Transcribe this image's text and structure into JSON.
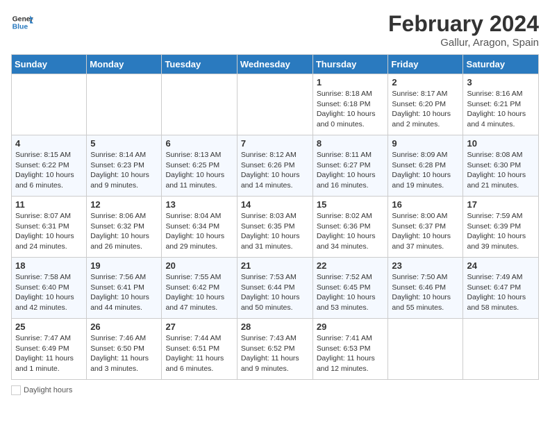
{
  "header": {
    "logo_line1": "General",
    "logo_line2": "Blue",
    "main_title": "February 2024",
    "subtitle": "Gallur, Aragon, Spain"
  },
  "days_of_week": [
    "Sunday",
    "Monday",
    "Tuesday",
    "Wednesday",
    "Thursday",
    "Friday",
    "Saturday"
  ],
  "weeks": [
    [
      {
        "day": "",
        "info": ""
      },
      {
        "day": "",
        "info": ""
      },
      {
        "day": "",
        "info": ""
      },
      {
        "day": "",
        "info": ""
      },
      {
        "day": "1",
        "info": "Sunrise: 8:18 AM\nSunset: 6:18 PM\nDaylight: 10 hours\nand 0 minutes."
      },
      {
        "day": "2",
        "info": "Sunrise: 8:17 AM\nSunset: 6:20 PM\nDaylight: 10 hours\nand 2 minutes."
      },
      {
        "day": "3",
        "info": "Sunrise: 8:16 AM\nSunset: 6:21 PM\nDaylight: 10 hours\nand 4 minutes."
      }
    ],
    [
      {
        "day": "4",
        "info": "Sunrise: 8:15 AM\nSunset: 6:22 PM\nDaylight: 10 hours\nand 6 minutes."
      },
      {
        "day": "5",
        "info": "Sunrise: 8:14 AM\nSunset: 6:23 PM\nDaylight: 10 hours\nand 9 minutes."
      },
      {
        "day": "6",
        "info": "Sunrise: 8:13 AM\nSunset: 6:25 PM\nDaylight: 10 hours\nand 11 minutes."
      },
      {
        "day": "7",
        "info": "Sunrise: 8:12 AM\nSunset: 6:26 PM\nDaylight: 10 hours\nand 14 minutes."
      },
      {
        "day": "8",
        "info": "Sunrise: 8:11 AM\nSunset: 6:27 PM\nDaylight: 10 hours\nand 16 minutes."
      },
      {
        "day": "9",
        "info": "Sunrise: 8:09 AM\nSunset: 6:28 PM\nDaylight: 10 hours\nand 19 minutes."
      },
      {
        "day": "10",
        "info": "Sunrise: 8:08 AM\nSunset: 6:30 PM\nDaylight: 10 hours\nand 21 minutes."
      }
    ],
    [
      {
        "day": "11",
        "info": "Sunrise: 8:07 AM\nSunset: 6:31 PM\nDaylight: 10 hours\nand 24 minutes."
      },
      {
        "day": "12",
        "info": "Sunrise: 8:06 AM\nSunset: 6:32 PM\nDaylight: 10 hours\nand 26 minutes."
      },
      {
        "day": "13",
        "info": "Sunrise: 8:04 AM\nSunset: 6:34 PM\nDaylight: 10 hours\nand 29 minutes."
      },
      {
        "day": "14",
        "info": "Sunrise: 8:03 AM\nSunset: 6:35 PM\nDaylight: 10 hours\nand 31 minutes."
      },
      {
        "day": "15",
        "info": "Sunrise: 8:02 AM\nSunset: 6:36 PM\nDaylight: 10 hours\nand 34 minutes."
      },
      {
        "day": "16",
        "info": "Sunrise: 8:00 AM\nSunset: 6:37 PM\nDaylight: 10 hours\nand 37 minutes."
      },
      {
        "day": "17",
        "info": "Sunrise: 7:59 AM\nSunset: 6:39 PM\nDaylight: 10 hours\nand 39 minutes."
      }
    ],
    [
      {
        "day": "18",
        "info": "Sunrise: 7:58 AM\nSunset: 6:40 PM\nDaylight: 10 hours\nand 42 minutes."
      },
      {
        "day": "19",
        "info": "Sunrise: 7:56 AM\nSunset: 6:41 PM\nDaylight: 10 hours\nand 44 minutes."
      },
      {
        "day": "20",
        "info": "Sunrise: 7:55 AM\nSunset: 6:42 PM\nDaylight: 10 hours\nand 47 minutes."
      },
      {
        "day": "21",
        "info": "Sunrise: 7:53 AM\nSunset: 6:44 PM\nDaylight: 10 hours\nand 50 minutes."
      },
      {
        "day": "22",
        "info": "Sunrise: 7:52 AM\nSunset: 6:45 PM\nDaylight: 10 hours\nand 53 minutes."
      },
      {
        "day": "23",
        "info": "Sunrise: 7:50 AM\nSunset: 6:46 PM\nDaylight: 10 hours\nand 55 minutes."
      },
      {
        "day": "24",
        "info": "Sunrise: 7:49 AM\nSunset: 6:47 PM\nDaylight: 10 hours\nand 58 minutes."
      }
    ],
    [
      {
        "day": "25",
        "info": "Sunrise: 7:47 AM\nSunset: 6:49 PM\nDaylight: 11 hours\nand 1 minute."
      },
      {
        "day": "26",
        "info": "Sunrise: 7:46 AM\nSunset: 6:50 PM\nDaylight: 11 hours\nand 3 minutes."
      },
      {
        "day": "27",
        "info": "Sunrise: 7:44 AM\nSunset: 6:51 PM\nDaylight: 11 hours\nand 6 minutes."
      },
      {
        "day": "28",
        "info": "Sunrise: 7:43 AM\nSunset: 6:52 PM\nDaylight: 11 hours\nand 9 minutes."
      },
      {
        "day": "29",
        "info": "Sunrise: 7:41 AM\nSunset: 6:53 PM\nDaylight: 11 hours\nand 12 minutes."
      },
      {
        "day": "",
        "info": ""
      },
      {
        "day": "",
        "info": ""
      }
    ]
  ],
  "footer": {
    "daylight_label": "Daylight hours"
  }
}
